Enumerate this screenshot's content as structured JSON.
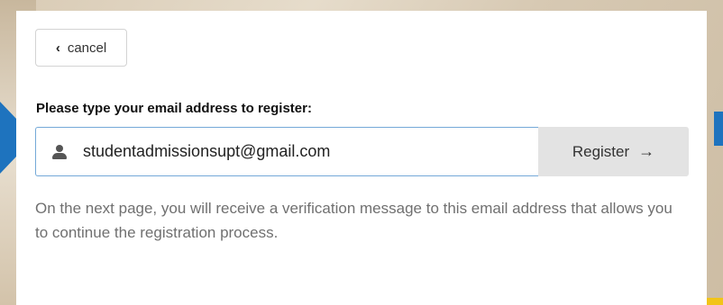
{
  "navigation": {
    "cancel_label": "cancel",
    "cancel_icon": "chevron-left-icon"
  },
  "form": {
    "label": "Please type your email address to register:",
    "email_value": "studentadmissionsupt@gmail.com",
    "email_icon": "user-icon",
    "register_label": "Register",
    "register_icon": "arrow-right-icon"
  },
  "info_text": "On the next page, you will receive a verification message to this email address that allows you to continue the registration process.",
  "colors": {
    "accent_blue": "#1e73be",
    "input_border": "#74a9d8",
    "button_bg": "#e3e3e3",
    "muted_text": "#707070",
    "yellow": "#f2c418"
  }
}
